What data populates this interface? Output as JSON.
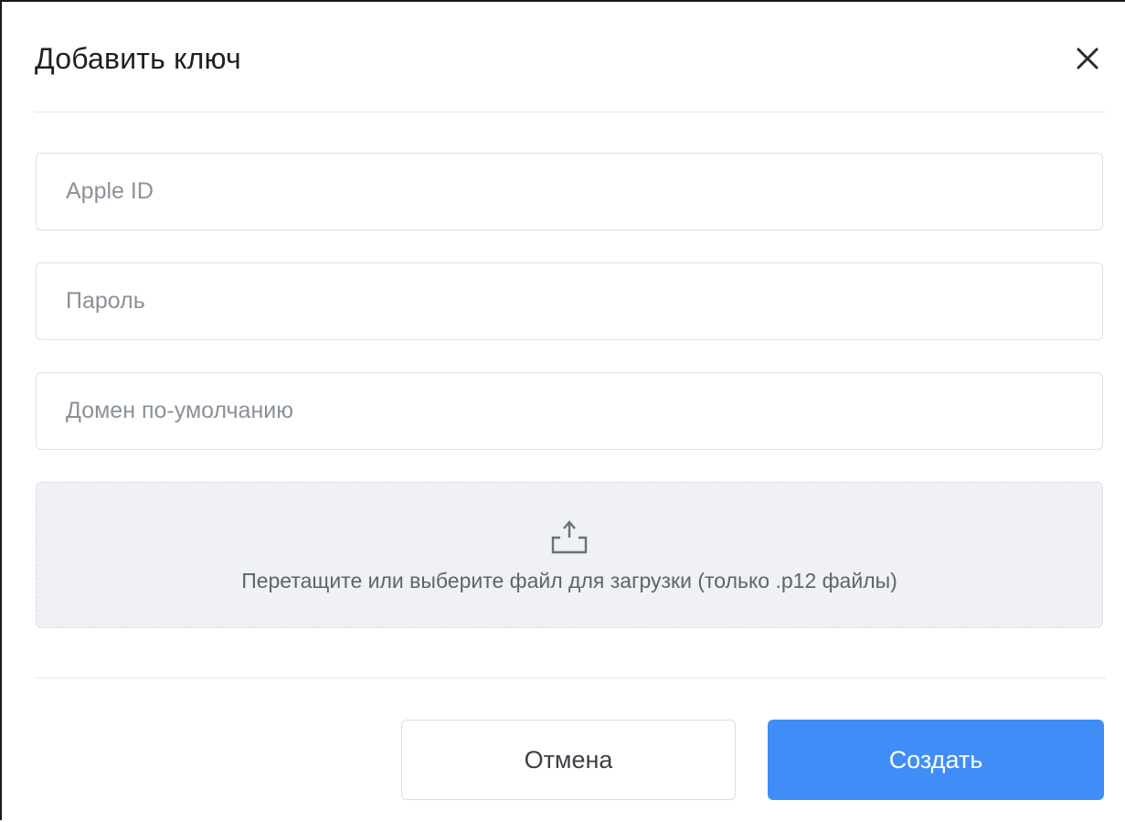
{
  "modal": {
    "title": "Добавить ключ",
    "close_icon": "close-icon"
  },
  "form": {
    "apple_id": {
      "value": "",
      "placeholder": "Apple ID"
    },
    "password": {
      "value": "",
      "placeholder": "Пароль"
    },
    "default_domain": {
      "value": "",
      "placeholder": "Домен по-умолчанию"
    }
  },
  "upload": {
    "icon": "upload-icon",
    "text": "Перетащите или выберите файл для загрузки (только .p12 файлы)"
  },
  "footer": {
    "cancel_label": "Отмена",
    "create_label": "Создать"
  },
  "colors": {
    "primary": "#3f8ef7",
    "dropzone_bg": "#eff1f4",
    "border": "#dde1e7"
  }
}
